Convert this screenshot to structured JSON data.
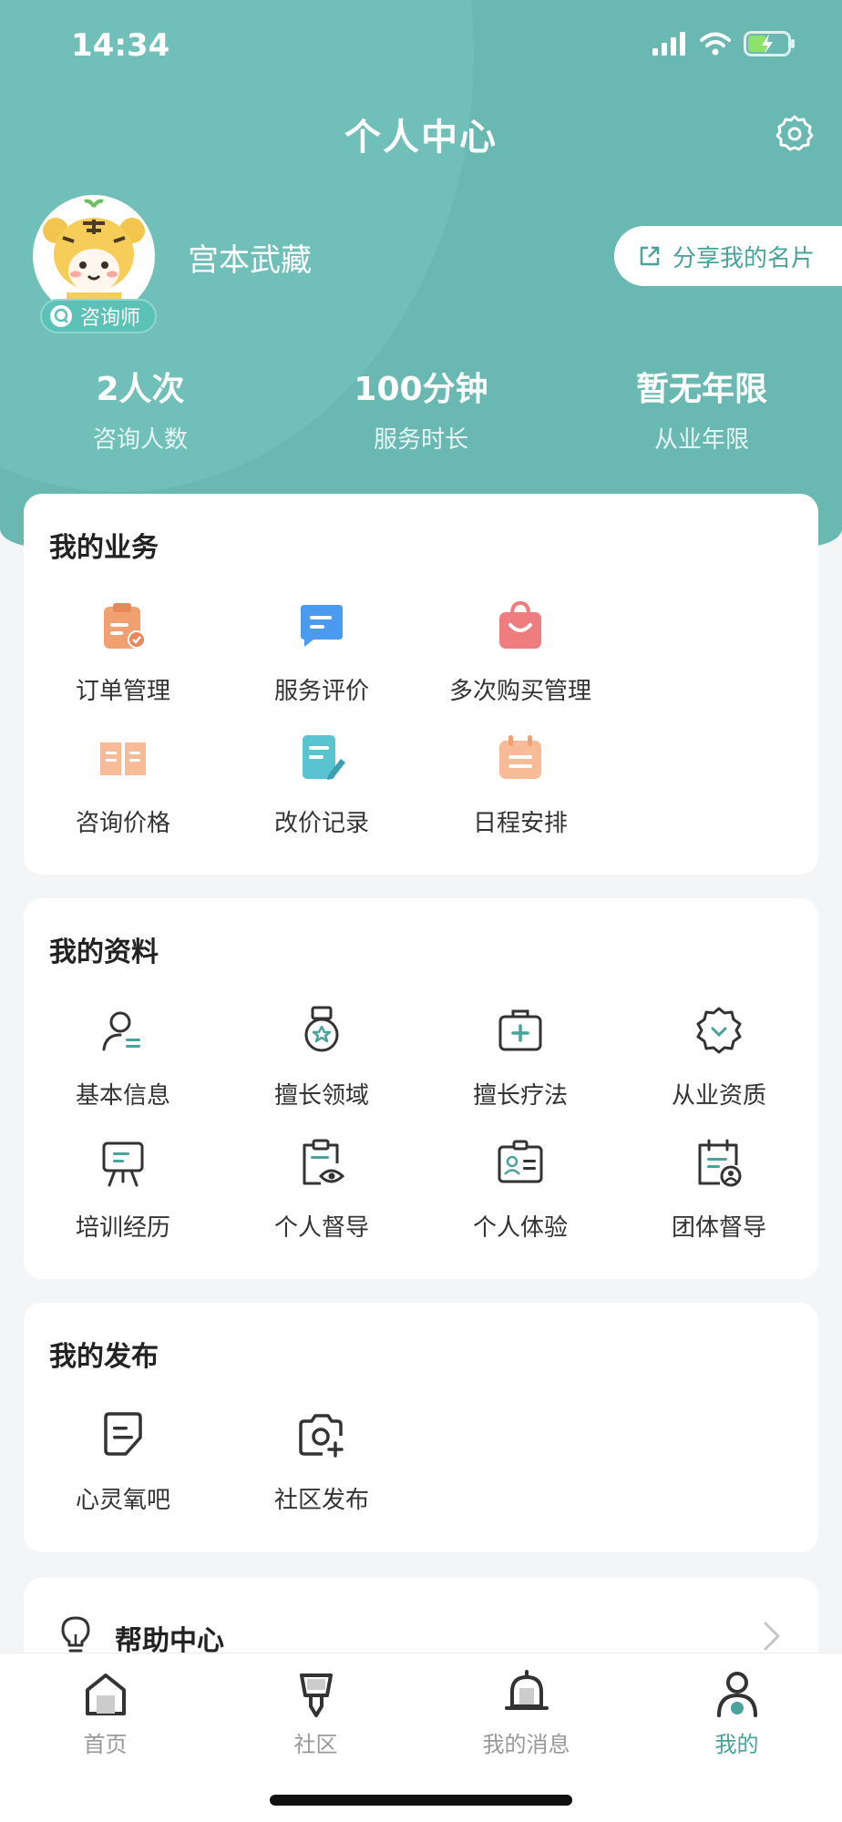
{
  "status_bar": {
    "time": "14:34"
  },
  "header": {
    "title": "个人中心",
    "username": "宫本武藏",
    "role_badge": "咨询师",
    "share_button": "分享我的名片",
    "stats": [
      {
        "value": "2人次",
        "label": "咨询人数"
      },
      {
        "value": "100分钟",
        "label": "服务时长"
      },
      {
        "value": "暂无年限",
        "label": "从业年限"
      }
    ]
  },
  "business": {
    "title": "我的业务",
    "items": [
      {
        "label": "订单管理",
        "icon": "order-clipboard-icon"
      },
      {
        "label": "服务评价",
        "icon": "chat-review-icon"
      },
      {
        "label": "多次购买管理",
        "icon": "shopping-bag-icon"
      },
      {
        "label": "咨询价格",
        "icon": "open-book-icon"
      },
      {
        "label": "改价记录",
        "icon": "edit-document-icon"
      },
      {
        "label": "日程安排",
        "icon": "calendar-icon"
      }
    ]
  },
  "profile": {
    "title": "我的资料",
    "items": [
      {
        "label": "基本信息",
        "icon": "user-info-icon"
      },
      {
        "label": "擅长领域",
        "icon": "medal-icon"
      },
      {
        "label": "擅长疗法",
        "icon": "medical-kit-icon"
      },
      {
        "label": "从业资质",
        "icon": "certified-badge-icon"
      },
      {
        "label": "培训经历",
        "icon": "easel-icon"
      },
      {
        "label": "个人督导",
        "icon": "clipboard-eye-icon"
      },
      {
        "label": "个人体验",
        "icon": "id-card-icon"
      },
      {
        "label": "团体督导",
        "icon": "calendar-group-icon"
      }
    ]
  },
  "publish": {
    "title": "我的发布",
    "items": [
      {
        "label": "心灵氧吧",
        "icon": "note-icon"
      },
      {
        "label": "社区发布",
        "icon": "camera-plus-icon"
      }
    ]
  },
  "help": {
    "label": "帮助中心",
    "icon": "lightbulb-icon"
  },
  "tabbar": {
    "items": [
      {
        "label": "首页",
        "icon": "home-icon"
      },
      {
        "label": "社区",
        "icon": "community-icon"
      },
      {
        "label": "我的消息",
        "icon": "bell-icon"
      },
      {
        "label": "我的",
        "icon": "user-icon",
        "active": true
      }
    ]
  },
  "colors": {
    "accent": "#4aa39b",
    "header_bg": "#69b9b2",
    "badge": "#5cc1b6"
  }
}
